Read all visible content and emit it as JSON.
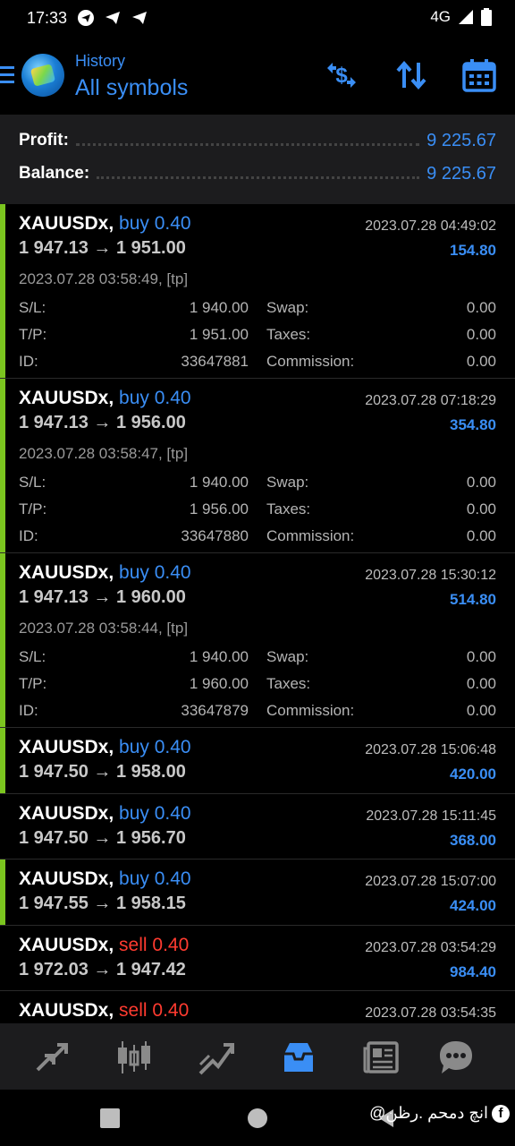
{
  "status_bar": {
    "time": "17:33",
    "network": "4G",
    "left_icons": [
      "telegram-icon",
      "telegram-send-icon",
      "telegram-send-icon"
    ],
    "right_icons": [
      "signal-icon",
      "battery-icon"
    ]
  },
  "header": {
    "subtitle": "History",
    "title": "All symbols",
    "actions": [
      "currency-exchange-icon",
      "sort-icon",
      "calendar-icon"
    ],
    "accent": "#3a8ef5"
  },
  "summary": {
    "profit_label": "Profit:",
    "profit_value": "9 225.67",
    "balance_label": "Balance:",
    "balance_value": "9 225.67"
  },
  "trades": [
    {
      "symbol": "XAUUSDx,",
      "side": "buy 0.40",
      "prices": "1 947.13 → 1 951.00",
      "close_time": "2023.07.28 04:49:02",
      "profit": "154.80",
      "open_time": "2023.07.28 03:58:49, [tp]",
      "sl_label": "S/L:",
      "sl": "1 940.00",
      "swap_label": "Swap:",
      "swap": "0.00",
      "tp_label": "T/P:",
      "tp": "1 951.00",
      "taxes_label": "Taxes:",
      "taxes": "0.00",
      "id_label": "ID:",
      "id": "33647881",
      "commission_label": "Commission:",
      "commission": "0.00"
    },
    {
      "symbol": "XAUUSDx,",
      "side": "buy 0.40",
      "prices": "1 947.13 → 1 956.00",
      "close_time": "2023.07.28 07:18:29",
      "profit": "354.80",
      "open_time": "2023.07.28 03:58:47, [tp]",
      "sl_label": "S/L:",
      "sl": "1 940.00",
      "swap_label": "Swap:",
      "swap": "0.00",
      "tp_label": "T/P:",
      "tp": "1 956.00",
      "taxes_label": "Taxes:",
      "taxes": "0.00",
      "id_label": "ID:",
      "id": "33647880",
      "commission_label": "Commission:",
      "commission": "0.00"
    },
    {
      "symbol": "XAUUSDx,",
      "side": "buy 0.40",
      "prices": "1 947.13 → 1 960.00",
      "close_time": "2023.07.28 15:30:12",
      "profit": "514.80",
      "open_time": "2023.07.28 03:58:44, [tp]",
      "sl_label": "S/L:",
      "sl": "1 940.00",
      "swap_label": "Swap:",
      "swap": "0.00",
      "tp_label": "T/P:",
      "tp": "1 960.00",
      "taxes_label": "Taxes:",
      "taxes": "0.00",
      "id_label": "ID:",
      "id": "33647879",
      "commission_label": "Commission:",
      "commission": "0.00"
    },
    {
      "symbol": "XAUUSDx,",
      "side": "buy 0.40",
      "prices": "1 947.50 → 1 958.00",
      "close_time": "2023.07.28 15:06:48",
      "profit": "420.00"
    },
    {
      "symbol": "XAUUSDx,",
      "side": "buy 0.40",
      "prices": "1 947.50 → 1 956.70",
      "close_time": "2023.07.28 15:11:45",
      "profit": "368.00"
    },
    {
      "symbol": "XAUUSDx,",
      "side": "buy 0.40",
      "prices": "1 947.55 → 1 958.15",
      "close_time": "2023.07.28 15:07:00",
      "profit": "424.00"
    },
    {
      "symbol": "XAUUSDx,",
      "side": "sell 0.40",
      "prices": "1 972.03 → 1 947.42",
      "close_time": "2023.07.28 03:54:29",
      "profit": "984.40"
    },
    {
      "symbol": "XAUUSDx,",
      "side": "sell 0.40",
      "prices": "",
      "close_time": "2023.07.28 03:54:35",
      "profit": ""
    }
  ],
  "bottom_nav": [
    "quotes-icon",
    "chart-icon",
    "trade-icon",
    "history-icon",
    "news-icon",
    "chat-icon"
  ],
  "watermark": "انچ دمحم .رظن@"
}
